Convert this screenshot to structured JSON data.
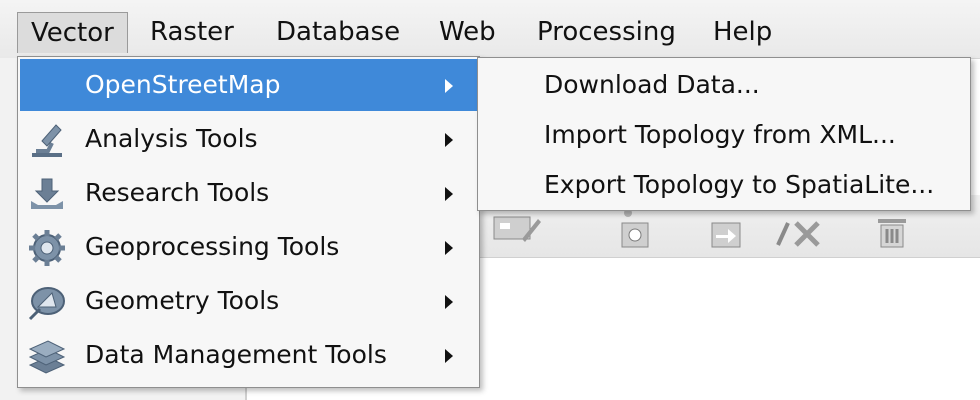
{
  "menubar": {
    "items": [
      {
        "label": "Vector"
      },
      {
        "label": "Raster"
      },
      {
        "label": "Database"
      },
      {
        "label": "Web"
      },
      {
        "label": "Processing"
      },
      {
        "label": "Help"
      }
    ]
  },
  "vector_menu": {
    "items": [
      {
        "label": "OpenStreetMap",
        "icon": "none",
        "has_submenu": true,
        "highlighted": true
      },
      {
        "label": "Analysis Tools",
        "icon": "microscope-icon",
        "has_submenu": true
      },
      {
        "label": "Research Tools",
        "icon": "download-arrow-icon",
        "has_submenu": true
      },
      {
        "label": "Geoprocessing Tools",
        "icon": "gear-icon",
        "has_submenu": true
      },
      {
        "label": "Geometry Tools",
        "icon": "geometry-icon",
        "has_submenu": true
      },
      {
        "label": "Data Management Tools",
        "icon": "layers-icon",
        "has_submenu": true
      }
    ]
  },
  "osm_submenu": {
    "items": [
      {
        "label": "Download Data..."
      },
      {
        "label": "Import Topology from XML..."
      },
      {
        "label": "Export Topology to SpatiaLite..."
      }
    ]
  },
  "colors": {
    "highlight": "#3f89d9",
    "menu_bg": "#f7f7f7"
  }
}
